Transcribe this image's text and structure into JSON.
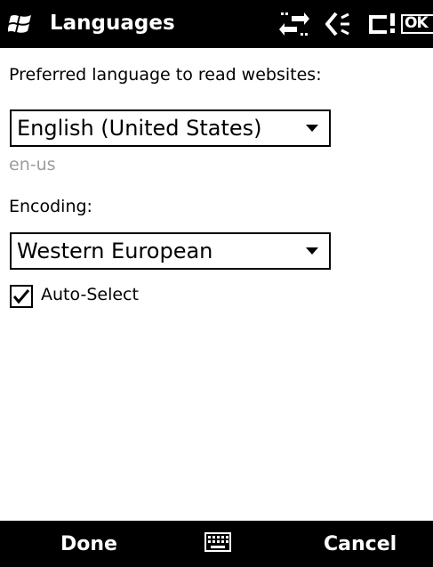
{
  "titlebar": {
    "title": "Languages",
    "icons": [
      "windows-logo-icon",
      "connectivity-icon",
      "volume-icon",
      "battery-icon"
    ],
    "ok_label": "OK"
  },
  "form": {
    "language_label": "Preferred language to read websites:",
    "language_selected": "English (United States)",
    "language_code": "en-us",
    "encoding_label": "Encoding:",
    "encoding_selected": "Western European",
    "auto_select_label": "Auto-Select",
    "auto_select_checked": true
  },
  "softkeys": {
    "left_label": "Done",
    "center_icon": "keyboard-icon",
    "right_label": "Cancel"
  }
}
